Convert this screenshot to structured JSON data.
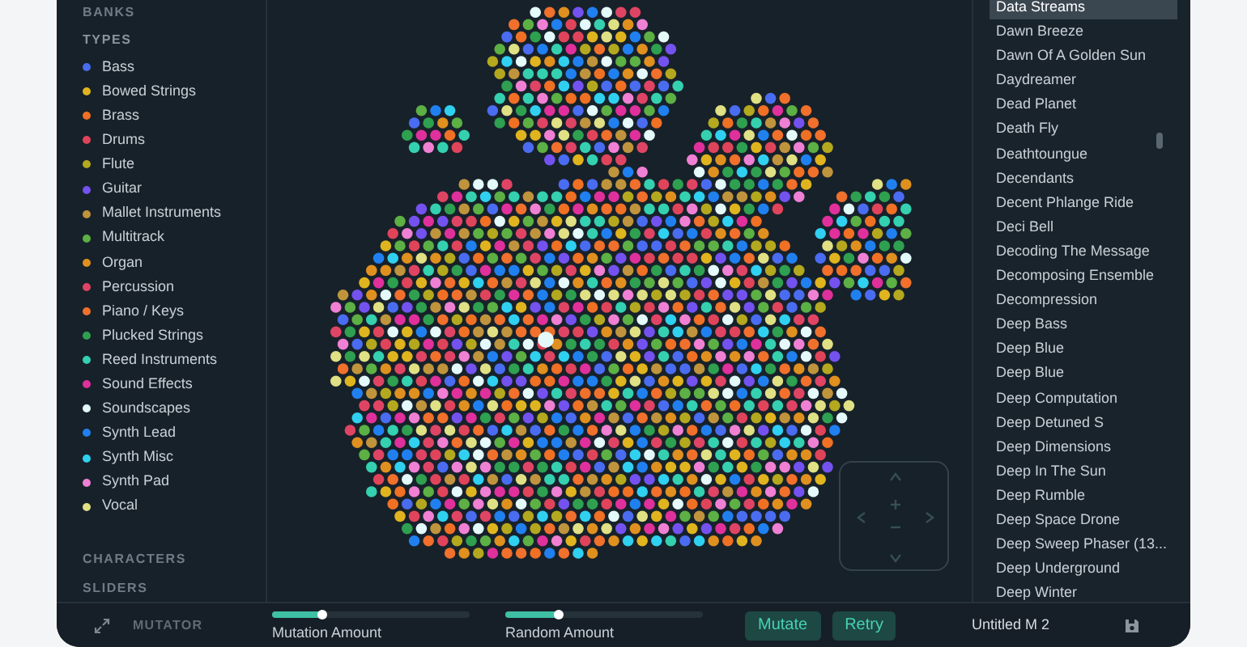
{
  "sidebar": {
    "sections": [
      {
        "label": "BANKS"
      },
      {
        "label": "TYPES",
        "items": [
          {
            "label": "Bass",
            "color": "#4a6cf0"
          },
          {
            "label": "Bowed Strings",
            "color": "#e0b41e"
          },
          {
            "label": "Brass",
            "color": "#f07024"
          },
          {
            "label": "Drums",
            "color": "#e0445a"
          },
          {
            "label": "Flute",
            "color": "#b4a81e"
          },
          {
            "label": "Guitar",
            "color": "#7452f0"
          },
          {
            "label": "Mallet Instruments",
            "color": "#c0943c"
          },
          {
            "label": "Multitrack",
            "color": "#5cb044"
          },
          {
            "label": "Organ",
            "color": "#e0901e"
          },
          {
            "label": "Percussion",
            "color": "#e04464"
          },
          {
            "label": "Piano / Keys",
            "color": "#f0702c"
          },
          {
            "label": "Plucked Strings",
            "color": "#2ea050"
          },
          {
            "label": "Reed Instruments",
            "color": "#34d0b0"
          },
          {
            "label": "Sound Effects",
            "color": "#e0309c"
          },
          {
            "label": "Soundscapes",
            "color": "#e4fafa"
          },
          {
            "label": "Synth Lead",
            "color": "#2080f0"
          },
          {
            "label": "Synth Misc",
            "color": "#30d0f0"
          },
          {
            "label": "Synth Pad",
            "color": "#f080d4"
          },
          {
            "label": "Vocal",
            "color": "#e0e084"
          }
        ]
      },
      {
        "label": "CHARACTERS"
      },
      {
        "label": "SLIDERS"
      }
    ]
  },
  "presets": [
    {
      "label": "Data Streams",
      "selected": true
    },
    {
      "label": "Dawn Breeze",
      "selected": false
    },
    {
      "label": "Dawn Of A Golden Sun",
      "selected": false
    },
    {
      "label": "Daydreamer",
      "selected": false
    },
    {
      "label": "Dead Planet",
      "selected": false
    },
    {
      "label": "Death Fly",
      "selected": false
    },
    {
      "label": "Deathtoungue",
      "selected": false
    },
    {
      "label": "Decendants",
      "selected": false
    },
    {
      "label": "Decent Phlange Ride",
      "selected": false
    },
    {
      "label": "Deci Bell",
      "selected": false
    },
    {
      "label": "Decoding The Message",
      "selected": false
    },
    {
      "label": "Decomposing Ensemble",
      "selected": false
    },
    {
      "label": "Decompression",
      "selected": false
    },
    {
      "label": "Deep Bass",
      "selected": false
    },
    {
      "label": "Deep Blue",
      "selected": false
    },
    {
      "label": "Deep Blue",
      "selected": false
    },
    {
      "label": "Deep Computation",
      "selected": false
    },
    {
      "label": "Deep Detuned S",
      "selected": false
    },
    {
      "label": "Deep Dimensions",
      "selected": false
    },
    {
      "label": "Deep In The Sun",
      "selected": false
    },
    {
      "label": "Deep Rumble",
      "selected": false
    },
    {
      "label": "Deep Space Drone",
      "selected": false
    },
    {
      "label": "Deep Sweep Phaser (13...",
      "selected": false
    },
    {
      "label": "Deep Underground",
      "selected": false
    },
    {
      "label": "Deep Winter",
      "selected": false
    }
  ],
  "bottom_bar": {
    "title": "MUTATOR",
    "sliders": [
      {
        "label": "Mutation Amount",
        "level": 0.25
      },
      {
        "label": "Random Amount",
        "level": 0.27
      }
    ],
    "buttons": [
      "Mutate",
      "Retry"
    ],
    "preset_name": "Untitled M 2"
  }
}
